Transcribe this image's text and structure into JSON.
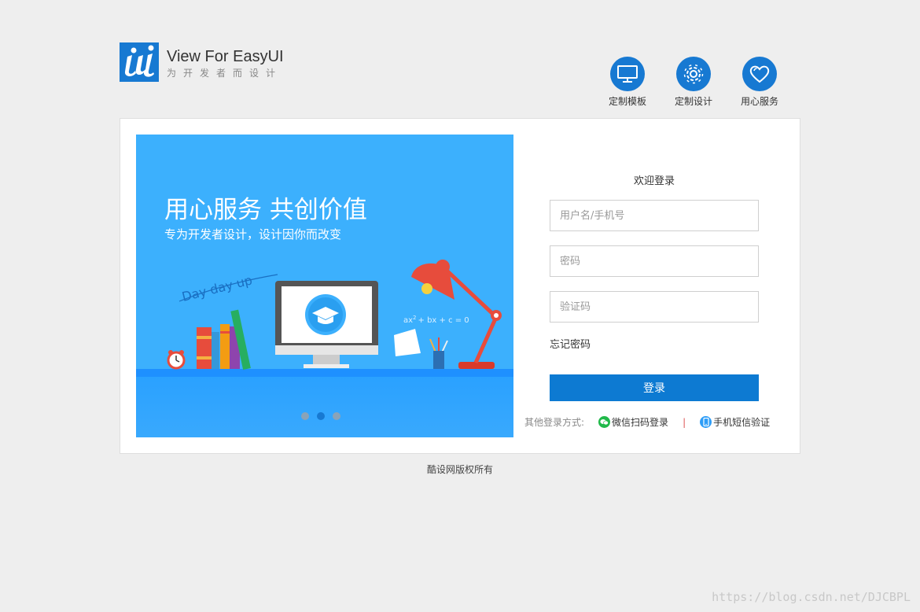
{
  "brand": {
    "title": "View For EasyUI",
    "subtitle": "为开发者而设计",
    "logo_icon": "ui-logo-icon",
    "accent": "#1779d2"
  },
  "features": [
    {
      "label": "定制模板",
      "icon": "monitor-icon"
    },
    {
      "label": "定制设计",
      "icon": "gear-icon"
    },
    {
      "label": "用心服务",
      "icon": "heart-icon"
    }
  ],
  "banner": {
    "title": "用心服务 共创价值",
    "subtitle": "专为开发者设计，设计因你而改变",
    "handwriting": "Day day up",
    "formula_a": "ax",
    "formula_exp": "2",
    "formula_b": "+ bx + c = 0",
    "slides": 3,
    "active_slide": 2,
    "background": "#3cb0fd"
  },
  "login": {
    "welcome": "欢迎登录",
    "username_placeholder": "用户名/手机号",
    "password_placeholder": "密码",
    "captcha_placeholder": "验证码",
    "forgot": "忘记密码",
    "submit": "登录",
    "other_label": "其他登录方式:",
    "wechat": "微信扫码登录",
    "separator": "|",
    "sms": "手机短信验证",
    "button_color": "#0d7ad2"
  },
  "footer": {
    "copyright": "酷设网版权所有"
  },
  "watermark": "https://blog.csdn.net/DJCBPL"
}
